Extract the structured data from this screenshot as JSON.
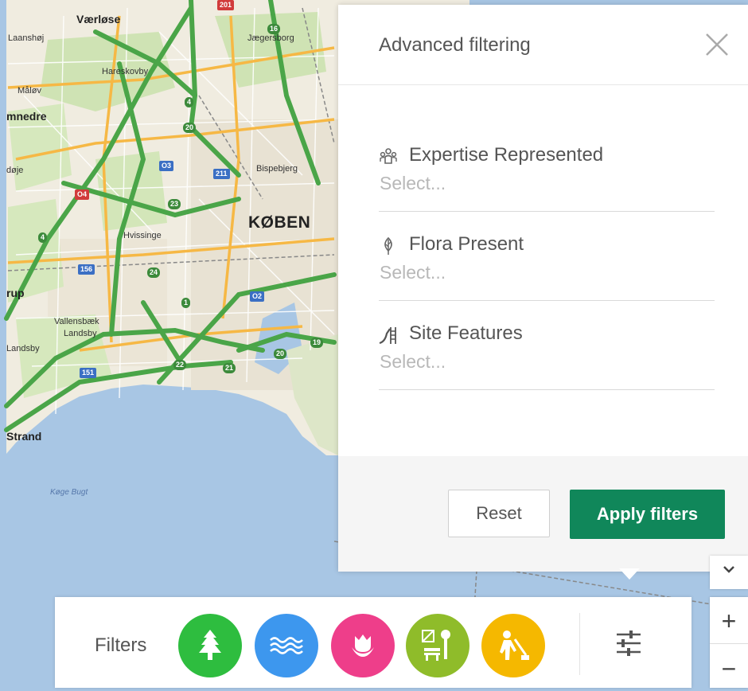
{
  "map": {
    "places": [
      "Værløse",
      "Laanshøj",
      "Hareskovby",
      "Jægersborg",
      "Måløv",
      "mnedre",
      "døje",
      "Bispebjerg",
      "KØBEN",
      "Hvissinge",
      "rup",
      "Vallensbæk",
      "Landsby",
      "Landsby",
      "Strand",
      "Køge Bugt"
    ],
    "routes": [
      "201",
      "16",
      "4",
      "O3",
      "211",
      "O4",
      "20",
      "23",
      "156",
      "24",
      "O2",
      "1",
      "19",
      "20",
      "22",
      "21",
      "151",
      "4"
    ]
  },
  "panel": {
    "title": "Advanced filtering",
    "fields": [
      {
        "label": "Expertise Represented",
        "placeholder": "Select...",
        "icon": "people-icon"
      },
      {
        "label": "Flora Present",
        "placeholder": "Select...",
        "icon": "leaf-icon"
      },
      {
        "label": "Site Features",
        "placeholder": "Select...",
        "icon": "slide-icon"
      }
    ],
    "reset_label": "Reset",
    "apply_label": "Apply filters"
  },
  "filterbar": {
    "label": "Filters",
    "buttons": [
      {
        "icon": "tree-icon",
        "color": "#2ebd3f"
      },
      {
        "icon": "water-icon",
        "color": "#3d97ee"
      },
      {
        "icon": "flower-icon",
        "color": "#ee3e8a"
      },
      {
        "icon": "park-bench-icon",
        "color": "#8fbc2a"
      },
      {
        "icon": "construction-worker-icon",
        "color": "#f5b800"
      }
    ]
  },
  "colors": {
    "accent": "#10875a",
    "land": "#f0ece0",
    "sea": "#a8c6e4",
    "motorway": "#4aa548",
    "major_road": "#f6b845"
  },
  "zoom": {
    "in_label": "+",
    "out_label": "−"
  }
}
